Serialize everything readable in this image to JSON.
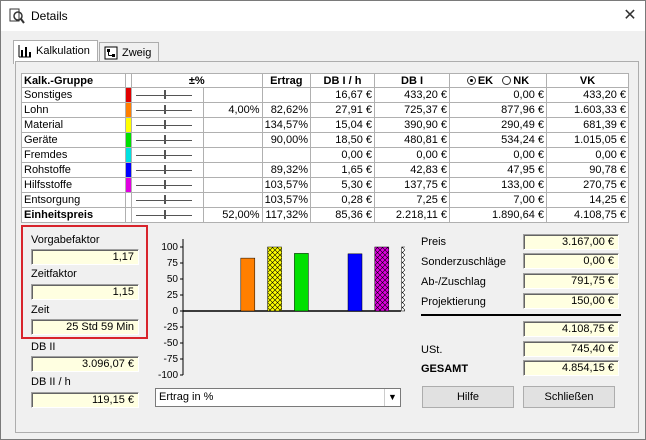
{
  "window": {
    "title": "Details",
    "close_glyph": "✕"
  },
  "tabs": [
    {
      "label": "Kalkulation",
      "icon": "bar-chart-icon"
    },
    {
      "label": "Zweig",
      "icon": "tree-icon"
    }
  ],
  "table": {
    "headers": {
      "group": "Kalk.-Gruppe",
      "pct": "±%",
      "ertrag": "Ertrag",
      "dbih": "DB I / h",
      "dbi": "DB I",
      "ek": "EK",
      "nk": "NK",
      "vk": "VK"
    },
    "rows": [
      {
        "name": "Sonstiges",
        "color": "#e00000",
        "pct": "",
        "ertrag": "",
        "dbih": "16,67 €",
        "dbi": "433,20 €",
        "eknk": "0,00 €",
        "vk": "433,20 €"
      },
      {
        "name": "Lohn",
        "color": "#ff7f00",
        "pct": "4,00%",
        "ertrag": "82,62%",
        "dbih": "27,91 €",
        "dbi": "725,37 €",
        "eknk": "877,96 €",
        "vk": "1.603,33 €"
      },
      {
        "name": "Material",
        "color": "#ffff00",
        "pct": "",
        "ertrag": "134,57%",
        "dbih": "15,04 €",
        "dbi": "390,90 €",
        "eknk": "290,49 €",
        "vk": "681,39 €"
      },
      {
        "name": "Geräte",
        "color": "#00e000",
        "pct": "",
        "ertrag": "90,00%",
        "dbih": "18,50 €",
        "dbi": "480,81 €",
        "eknk": "534,24 €",
        "vk": "1.015,05 €"
      },
      {
        "name": "Fremdes",
        "color": "#00e0e0",
        "pct": "",
        "ertrag": "",
        "dbih": "0,00 €",
        "dbi": "0,00 €",
        "eknk": "0,00 €",
        "vk": "0,00 €"
      },
      {
        "name": "Rohstoffe",
        "color": "#0000ff",
        "pct": "",
        "ertrag": "89,32%",
        "dbih": "1,65 €",
        "dbi": "42,83 €",
        "eknk": "47,95 €",
        "vk": "90,78 €"
      },
      {
        "name": "Hilfsstoffe",
        "color": "#e000e0",
        "pct": "",
        "ertrag": "103,57%",
        "dbih": "5,30 €",
        "dbi": "137,75 €",
        "eknk": "133,00 €",
        "vk": "270,75 €"
      },
      {
        "name": "Entsorgung",
        "color": "#ffffff",
        "pct": "",
        "ertrag": "103,57%",
        "dbih": "0,28 €",
        "dbi": "7,25 €",
        "eknk": "7,00 €",
        "vk": "14,25 €"
      }
    ],
    "total": {
      "name": "Einheitspreis",
      "pct": "52,00%",
      "ertrag": "117,32%",
      "dbih": "85,36 €",
      "dbi": "2.218,11 €",
      "eknk": "1.890,64 €",
      "vk": "4.108,75 €"
    }
  },
  "left": {
    "vorgabefaktor_label": "Vorgabefaktor",
    "vorgabefaktor": "1,17",
    "zeitfaktor_label": "Zeitfaktor",
    "zeitfaktor": "1,15",
    "zeit_label": "Zeit",
    "zeit": "25 Std 59 Min",
    "db2_label": "DB II",
    "db2": "3.096,07 €",
    "db2h_label": "DB II / h",
    "db2h": "119,15 €"
  },
  "chart_data": {
    "type": "bar",
    "categories": [
      "Sonstiges",
      "Lohn",
      "Material",
      "Geräte",
      "Fremdes",
      "Rohstoffe",
      "Hilfsstoffe",
      "Entsorgung"
    ],
    "values": [
      0,
      82.62,
      134.57,
      90.0,
      0,
      89.32,
      103.57,
      103.57
    ],
    "colors": [
      "#e00000",
      "#ff7f00",
      "#ffff00",
      "#00e000",
      "#00e0e0",
      "#0000ff",
      "#e000e0",
      "#ffffff"
    ],
    "hatched": [
      false,
      false,
      true,
      false,
      false,
      false,
      true,
      true
    ],
    "ylim": [
      -100,
      100
    ],
    "yticks": [
      "100",
      "75",
      "50",
      "25",
      "0",
      "-25",
      "-50",
      "-75",
      "-100"
    ],
    "ytick_values": [
      100,
      75,
      50,
      25,
      0,
      -25,
      -50,
      -75,
      -100
    ],
    "mode_select": "Ertrag in %"
  },
  "right": {
    "preis_label": "Preis",
    "preis": "3.167,00 €",
    "sonder_label": "Sonderzuschläge",
    "sonder": "0,00 €",
    "abzu_label": "Ab-/Zuschlag",
    "abzu": "791,75 €",
    "proj_label": "Projektierung",
    "proj": "150,00 €",
    "summe": "4.108,75 €",
    "ust_label": "USt.",
    "ust": "745,40 €",
    "gesamt_label": "GESAMT",
    "gesamt": "4.854,15 €"
  },
  "buttons": {
    "hilfe": "Hilfe",
    "schliessen": "Schließen"
  }
}
